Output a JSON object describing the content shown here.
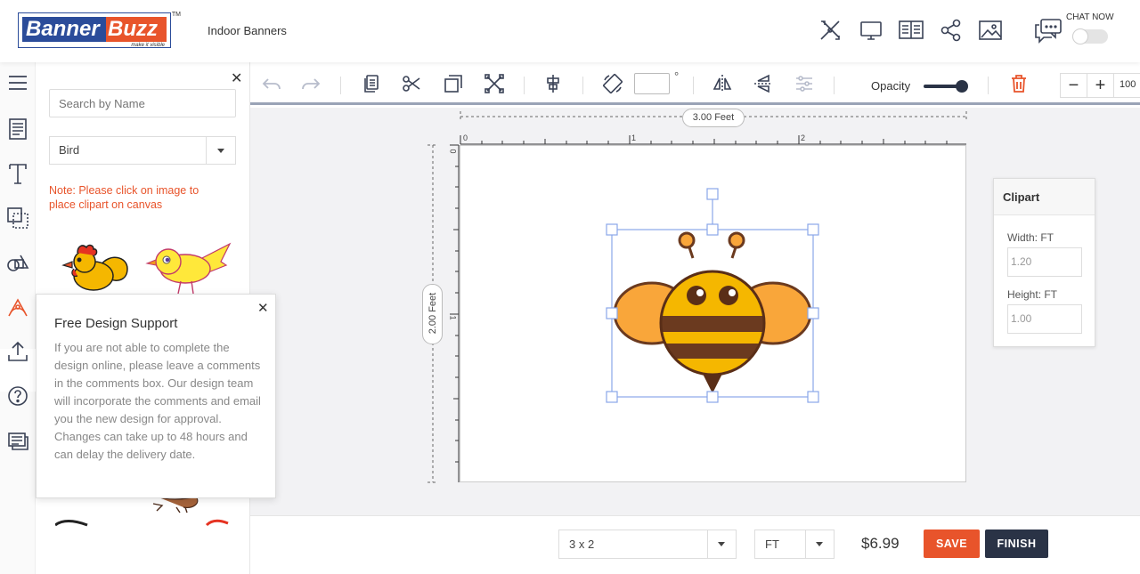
{
  "header": {
    "logo_part1": "Banner",
    "logo_part2": "Buzz",
    "logo_tagline": "make it visible",
    "logo_tm": "TM",
    "product_name": "Indoor Banners",
    "icons": [
      "edit-tools-icon",
      "monitor-preview-icon",
      "book-view-icon",
      "share-icon",
      "image-icon",
      "chat-icon"
    ],
    "chat_label": "CHAT NOW",
    "chat_toggle_on": false
  },
  "sidebar_icons": [
    "menu-icon",
    "template-icon",
    "text-icon",
    "background-icon",
    "shapes-icon",
    "clipart-icon",
    "upload-icon",
    "help-icon",
    "comments-icon"
  ],
  "clipart_panel": {
    "search_placeholder": "Search by Name",
    "category": "Bird",
    "note": "Note: Please click on image to place clipart on canvas"
  },
  "support_popup": {
    "title": "Free Design Support",
    "body": "If you are not able to complete the design online, please leave a comments in the comments box. Our design team will incorporate the comments and email you the new design for approval. Changes can take up to 48 hours and can delay the delivery date."
  },
  "toolbar": {
    "icons": [
      "undo-icon",
      "redo-icon",
      "copy-icon",
      "cut-icon",
      "duplicate-icon",
      "crop-icon",
      "align-icon",
      "rotate-icon",
      "flip-horizontal-icon",
      "flip-vertical-icon",
      "adjust-icon",
      "delete-icon"
    ],
    "rotation_value": "",
    "degree_symbol": "°",
    "opacity_label": "Opacity",
    "opacity_value": 1.0,
    "zoom_minus": "−",
    "zoom_plus": "+",
    "zoom_value": "100"
  },
  "canvas": {
    "width_label": "3.00 Feet",
    "height_label": "2.00 Feet",
    "ruler_x": [
      "0",
      "1",
      "2"
    ],
    "ruler_y": [
      "0",
      "1"
    ],
    "selected_clipart": "bee"
  },
  "clipart_props": {
    "title": "Clipart",
    "width_label": "Width: FT",
    "width_value": "1.20",
    "height_label": "Height: FT",
    "height_value": "1.00"
  },
  "footer": {
    "size": "3 x 2",
    "unit": "FT",
    "price": "$6.99",
    "save_label": "SAVE",
    "finish_label": "FINISH"
  },
  "colors": {
    "brand_blue": "#2b4c9a",
    "brand_orange": "#e8542b",
    "dark_navy": "#2a3346",
    "bee_yellow": "#f5b700",
    "bee_brown": "#6b3a1f",
    "wing_orange": "#f9a63a"
  }
}
